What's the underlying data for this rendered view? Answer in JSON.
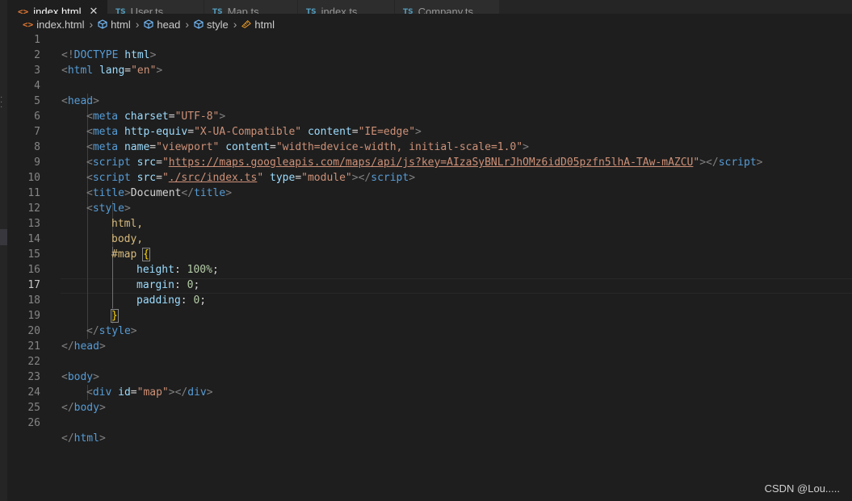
{
  "tabs": [
    {
      "label": "index.html",
      "icon": "<>",
      "active": true,
      "left": 0,
      "width": 124
    },
    {
      "label": "User.ts",
      "icon": "TS",
      "active": false
    },
    {
      "label": "Map.ts",
      "icon": "TS",
      "active": false
    },
    {
      "label": "index.ts",
      "icon": "TS",
      "active": false
    },
    {
      "label": "Company.ts",
      "icon": "TS",
      "active": false
    }
  ],
  "breadcrumb": {
    "file": "index.html",
    "path": [
      "html",
      "head",
      "style",
      "html"
    ]
  },
  "editor": {
    "active_line": 17,
    "line_numbers": [
      "1",
      "2",
      "3",
      "4",
      "5",
      "6",
      "7",
      "8",
      "9",
      "10",
      "11",
      "12",
      "13",
      "14",
      "15",
      "16",
      "17",
      "18",
      "19",
      "20",
      "21",
      "22",
      "23",
      "24",
      "25",
      "26"
    ],
    "lines": {
      "l1": {
        "lt": "<!",
        "kw": "DOCTYPE",
        "name": "html",
        "gt": ">"
      },
      "l2": {
        "tag": "html",
        "attr": "lang",
        "eq": "=",
        "val": "\"en\""
      },
      "l4": {
        "tag": "head"
      },
      "l5": {
        "tag": "meta",
        "attr": "charset",
        "val": "\"UTF-8\""
      },
      "l6": {
        "tag": "meta",
        "attr1": "http-equiv",
        "val1": "\"X-UA-Compatible\"",
        "attr2": "content",
        "val2": "\"IE=edge\""
      },
      "l7": {
        "tag": "meta",
        "attr1": "name",
        "val1": "\"viewport\"",
        "attr2": "content",
        "val2": "\"width=device-width, initial-scale=1.0\""
      },
      "l8": {
        "tag": "script",
        "attr": "src",
        "q1": "\"",
        "url": "https://maps.googleapis.com/maps/api/js?key=AIzaSyBNLrJhOMz6idD05pzfn5lhA-TAw-mAZCU",
        "q2": "\"",
        "close": "script"
      },
      "l9": {
        "tag": "script",
        "attr1": "src",
        "q1": "\"",
        "path": "./src/index.ts",
        "q2": "\"",
        "attr2": "type",
        "val2": "\"module\"",
        "close": "script"
      },
      "l10": {
        "tag": "title",
        "text": "Document",
        "close": "title"
      },
      "l11": {
        "tag": "style"
      },
      "l12": {
        "sel": "html,"
      },
      "l13": {
        "sel": "body,"
      },
      "l14": {
        "sel": "#map",
        "brace": "{"
      },
      "l15": {
        "prop": "height",
        "colon": ": ",
        "val": "100%",
        "semi": ";"
      },
      "l16": {
        "prop": "margin",
        "colon": ": ",
        "val": "0",
        "semi": ";"
      },
      "l17": {
        "prop": "padding",
        "colon": ": ",
        "val": "0",
        "semi": ";"
      },
      "l18": {
        "brace": "}"
      },
      "l19": {
        "close": "style"
      },
      "l20": {
        "close": "head"
      },
      "l22": {
        "tag": "body"
      },
      "l23": {
        "tag": "div",
        "attr": "id",
        "val": "\"map\"",
        "close": "div"
      },
      "l24": {
        "close": "body"
      },
      "l26": {
        "close": "html"
      }
    }
  },
  "watermark": "CSDN @Lou....."
}
